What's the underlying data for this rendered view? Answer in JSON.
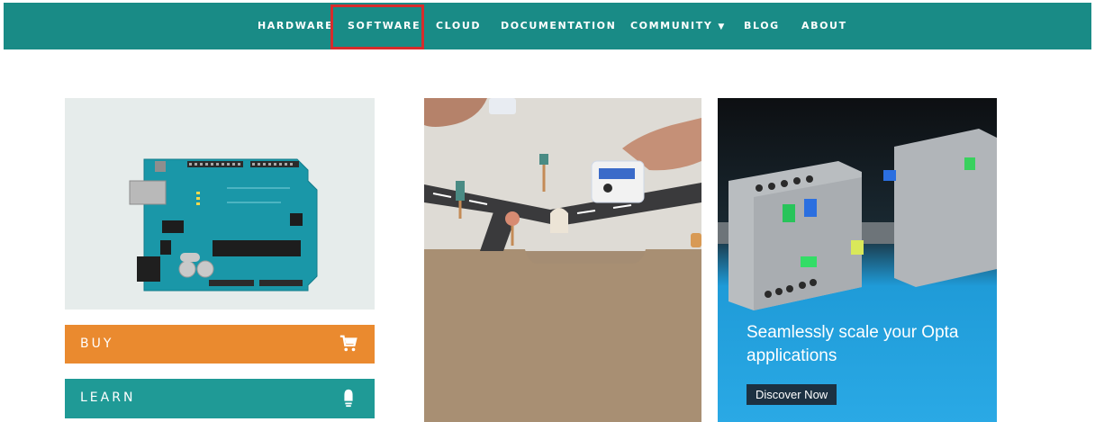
{
  "nav": {
    "items": [
      {
        "label": "HARDWARE"
      },
      {
        "label": "SOFTWARE"
      },
      {
        "label": "CLOUD"
      },
      {
        "label": "DOCUMENTATION"
      },
      {
        "label": "COMMUNITY",
        "icon": "caret-down-icon"
      },
      {
        "label": "BLOG"
      },
      {
        "label": "ABOUT"
      }
    ],
    "highlighted": "SOFTWARE",
    "colors": {
      "background": "#198b86",
      "text": "#ffffff",
      "highlight_border": "#d62c2c"
    }
  },
  "buy": {
    "label": "BUY",
    "icon": "shopping-cart-icon",
    "color": "#ea8a2f"
  },
  "learn": {
    "label": "LEARN",
    "icon": "lightbulb-icon",
    "color": "#1f9a96"
  },
  "promo": {
    "headline": "Seamlessly scale your Opta applications",
    "cta": "Discover Now",
    "colors": {
      "background": "#2aa9e5",
      "cta_background": "#1c3142"
    }
  }
}
